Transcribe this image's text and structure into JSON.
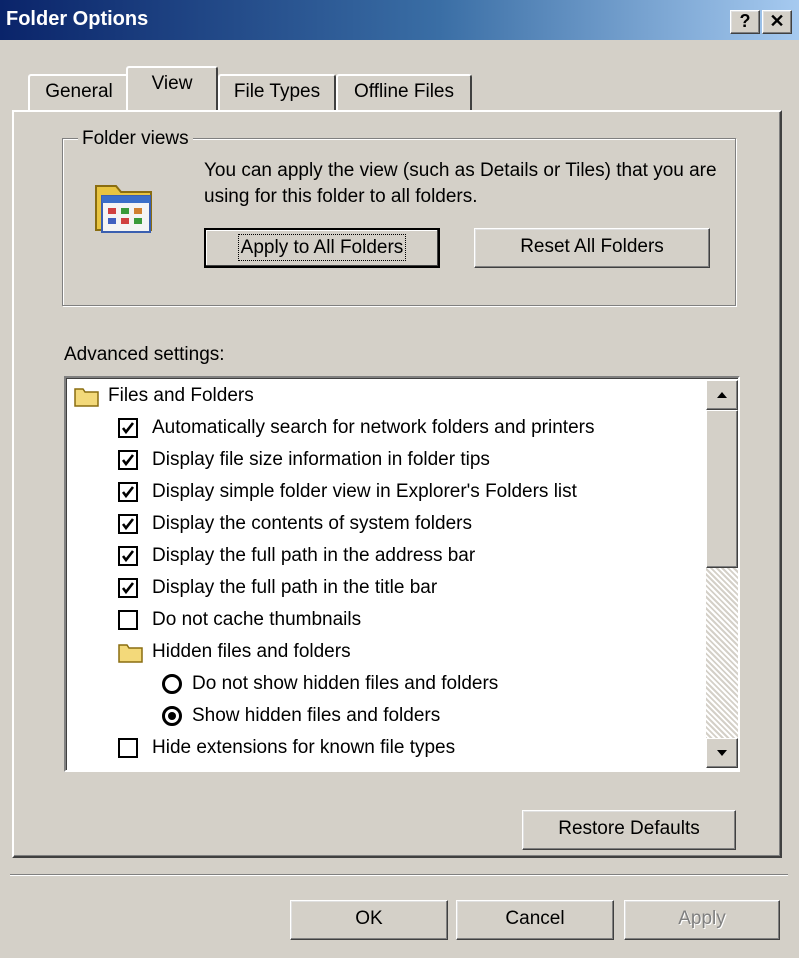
{
  "window": {
    "title": "Folder Options",
    "help_label": "?",
    "close_label": "✕"
  },
  "tabs": [
    {
      "label": "General",
      "active": false
    },
    {
      "label": "View",
      "active": true
    },
    {
      "label": "File Types",
      "active": false
    },
    {
      "label": "Offline Files",
      "active": false
    }
  ],
  "folder_views": {
    "legend": "Folder views",
    "description": "You can apply the view (such as Details or Tiles) that you are using for this folder to all folders.",
    "apply_button": "Apply to All Folders",
    "reset_button": "Reset All Folders"
  },
  "advanced": {
    "label": "Advanced settings:",
    "items": [
      {
        "type": "folder",
        "label": "Files and Folders"
      },
      {
        "type": "checkbox",
        "label": "Automatically search for network folders and printers",
        "checked": true
      },
      {
        "type": "checkbox",
        "label": "Display file size information in folder tips",
        "checked": true
      },
      {
        "type": "checkbox",
        "label": "Display simple folder view in Explorer's Folders list",
        "checked": true
      },
      {
        "type": "checkbox",
        "label": "Display the contents of system folders",
        "checked": true
      },
      {
        "type": "checkbox",
        "label": "Display the full path in the address bar",
        "checked": true
      },
      {
        "type": "checkbox",
        "label": "Display the full path in the title bar",
        "checked": true
      },
      {
        "type": "checkbox",
        "label": "Do not cache thumbnails",
        "checked": false
      },
      {
        "type": "folder",
        "label": "Hidden files and folders"
      },
      {
        "type": "radio",
        "label": "Do not show hidden files and folders",
        "selected": false
      },
      {
        "type": "radio",
        "label": "Show hidden files and folders",
        "selected": true
      },
      {
        "type": "checkbox",
        "label": "Hide extensions for known file types",
        "checked": false
      }
    ],
    "restore_button": "Restore Defaults"
  },
  "footer": {
    "ok": "OK",
    "cancel": "Cancel",
    "apply": "Apply"
  }
}
